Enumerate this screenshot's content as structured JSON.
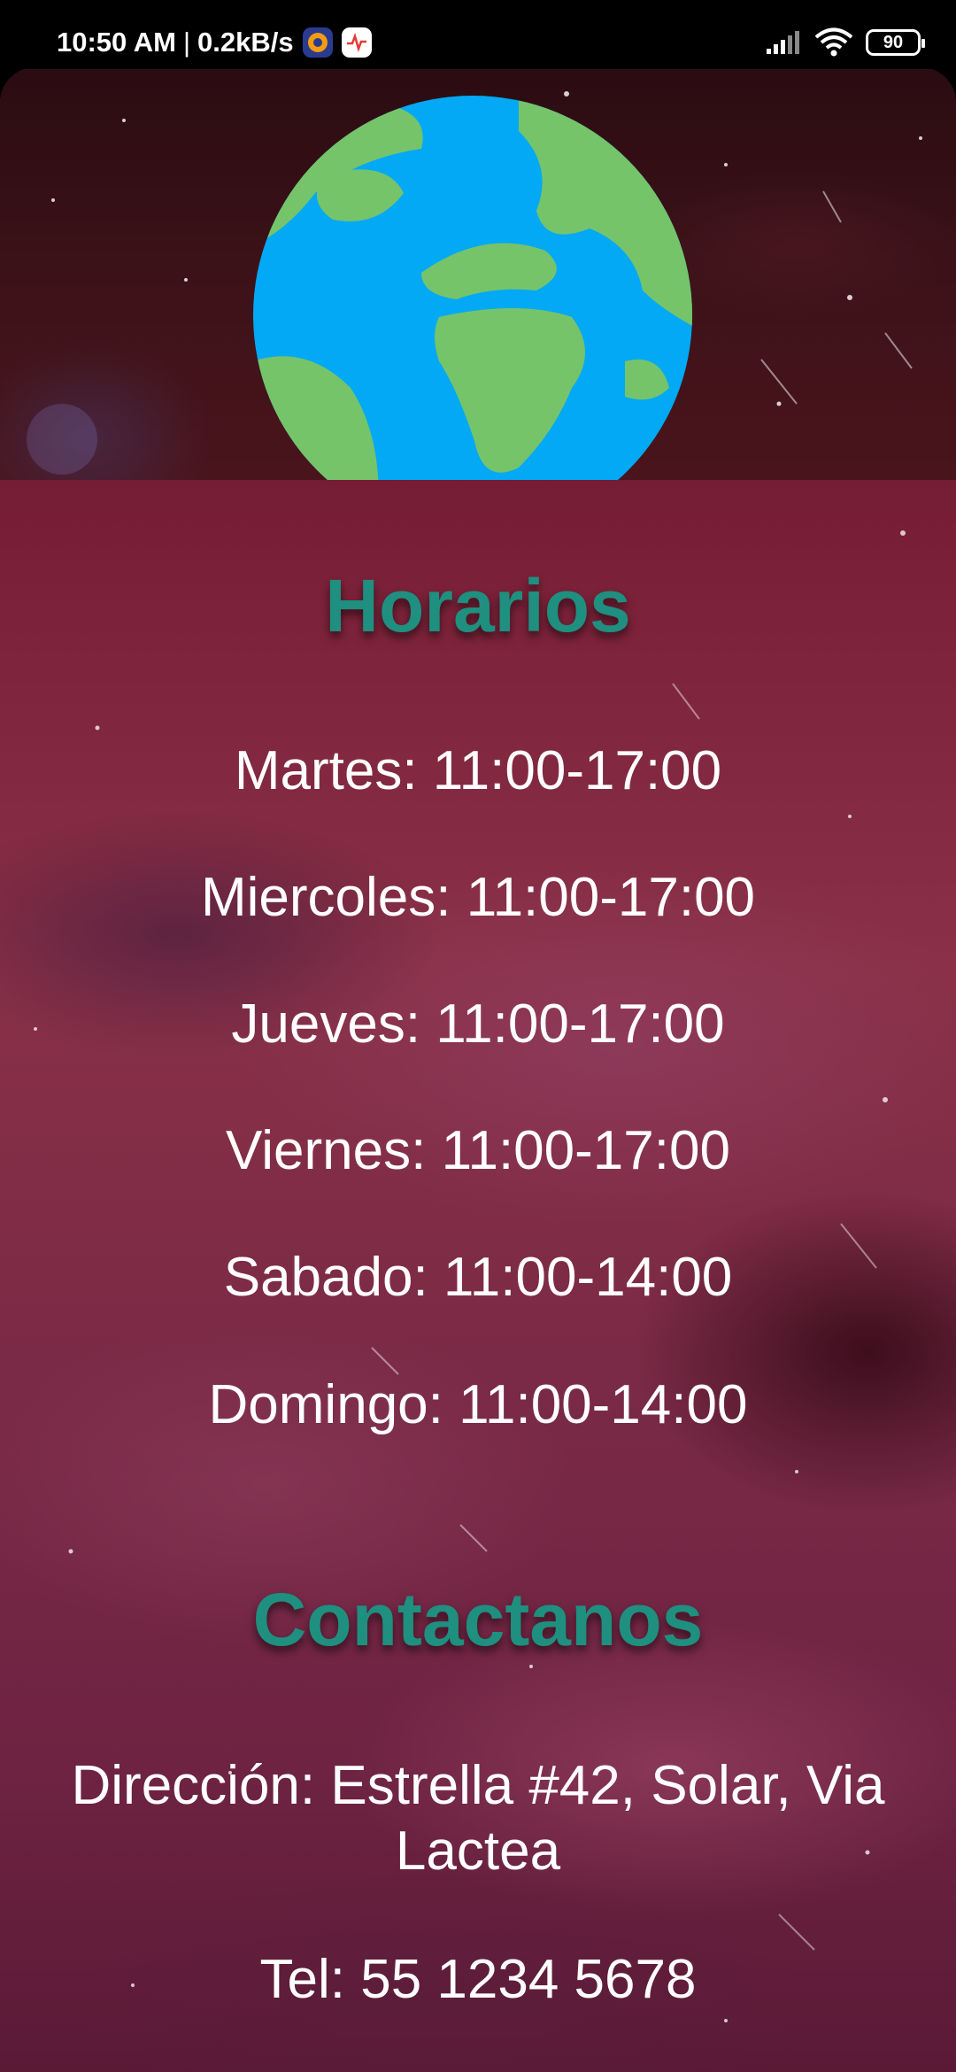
{
  "status_bar": {
    "time": "10:50 AM",
    "separator": "|",
    "speed": "0.2kB/s",
    "battery": "90",
    "icons": [
      "app-notification-icon",
      "heartbeat-app-icon",
      "signal-icon",
      "wifi-icon",
      "battery-icon"
    ]
  },
  "header": {
    "image": "earth-globe-icon"
  },
  "schedule": {
    "title": "Horarios",
    "days": [
      "Martes: 11:00-17:00",
      "Miercoles: 11:00-17:00",
      "Jueves: 11:00-17:00",
      "Viernes: 11:00-17:00",
      "Sabado: 11:00-14:00",
      "Domingo: 11:00-14:00"
    ]
  },
  "contact": {
    "title": "Contactanos",
    "address": "Dirección: Estrella #42, Solar, Via Lactea",
    "phone": "Tel: 55 1234 5678"
  },
  "colors": {
    "title_accent": "#1f8f80",
    "text": "#ffffff",
    "globe_ocean": "#03a9f4",
    "globe_land": "#75c46a"
  }
}
